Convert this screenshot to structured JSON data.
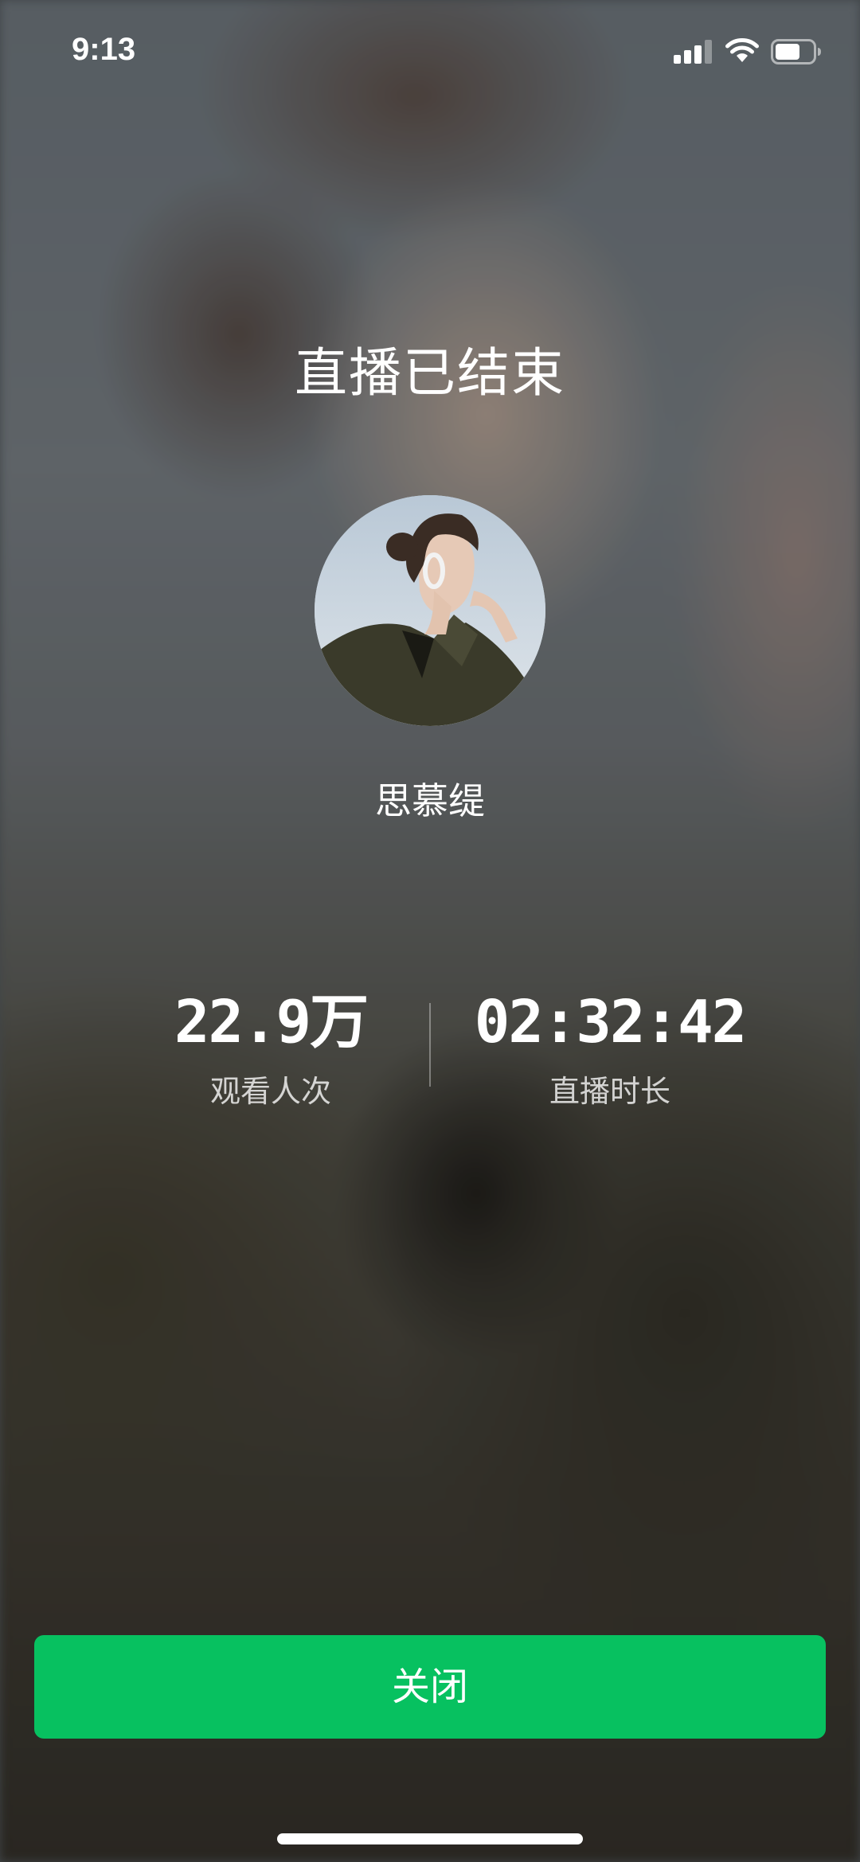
{
  "status_bar": {
    "time": "9:13",
    "signal_icon": "cellular-signal-icon",
    "wifi_icon": "wifi-icon",
    "battery_icon": "battery-icon"
  },
  "title": "直播已结束",
  "host": {
    "avatar": "host-avatar-photo",
    "name": "思慕缇"
  },
  "stats": {
    "viewers": {
      "value": "22.9万",
      "label": "观看人次"
    },
    "duration": {
      "value": "02:32:42",
      "label": "直播时长"
    }
  },
  "close_button": {
    "label": "关闭"
  },
  "colors": {
    "accent": "#07c160",
    "text": "#ffffff"
  }
}
